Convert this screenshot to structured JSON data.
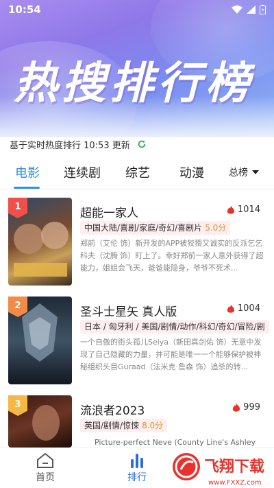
{
  "status_bar": {
    "time": "10:54"
  },
  "hero": {
    "title": "热搜排行榜"
  },
  "update_info": {
    "text": "基于实时热度排行 10:53 更新"
  },
  "tabs": [
    {
      "label": "电影",
      "active": true
    },
    {
      "label": "连续剧",
      "active": false
    },
    {
      "label": "综艺",
      "active": false
    },
    {
      "label": "动漫",
      "active": false
    }
  ],
  "rank_select": {
    "label": "总榜"
  },
  "items": [
    {
      "rank": "1",
      "title": "超能一家人",
      "heat": "1014",
      "tags": "中国大陆/喜剧/家庭/奇幻/喜剧片",
      "score": "5.0分",
      "description": "郑前（艾伦 饰）新开发的APP被狡猾又诚实的反派乞乞科夫（沈腾 饰）盯上了。幸好郑前一家人意外获得了超能力，姐姐会飞天，爸爸能隐身，爷爷不死术..."
    },
    {
      "rank": "2",
      "title": "圣斗士星矢 真人版",
      "heat": "1004",
      "tags": "日本 / 匈牙利 / 美国/剧情/动作/科幻/奇幻/冒险/剧",
      "score": "",
      "description": "一个自傲的街头孤儿Seiya（新田真剑佑 饰）无意中发现了自己隐藏的力量，并可能是唯一一个能够保护被神秘组织头目Guraad（法米克·詹森 饰）追杀的转..."
    },
    {
      "rank": "3",
      "title": "流浪者2023",
      "heat": "999",
      "tags": "英国/剧情/惊悚",
      "score": "8.0分",
      "description": "Picture-perfect Neve (County Line's Ashley"
    }
  ],
  "bottom_nav": [
    {
      "label": "首页",
      "active": false
    },
    {
      "label": "排行",
      "active": true
    }
  ],
  "watermark": {
    "text": "飞翔下载",
    "url": "www.FXXZ.com"
  },
  "colors": {
    "accent": "#2a8de8",
    "rank1": "#f0504a",
    "rank2": "#f28a4a",
    "rank3": "#f5b844",
    "heat": "#e8322e"
  }
}
